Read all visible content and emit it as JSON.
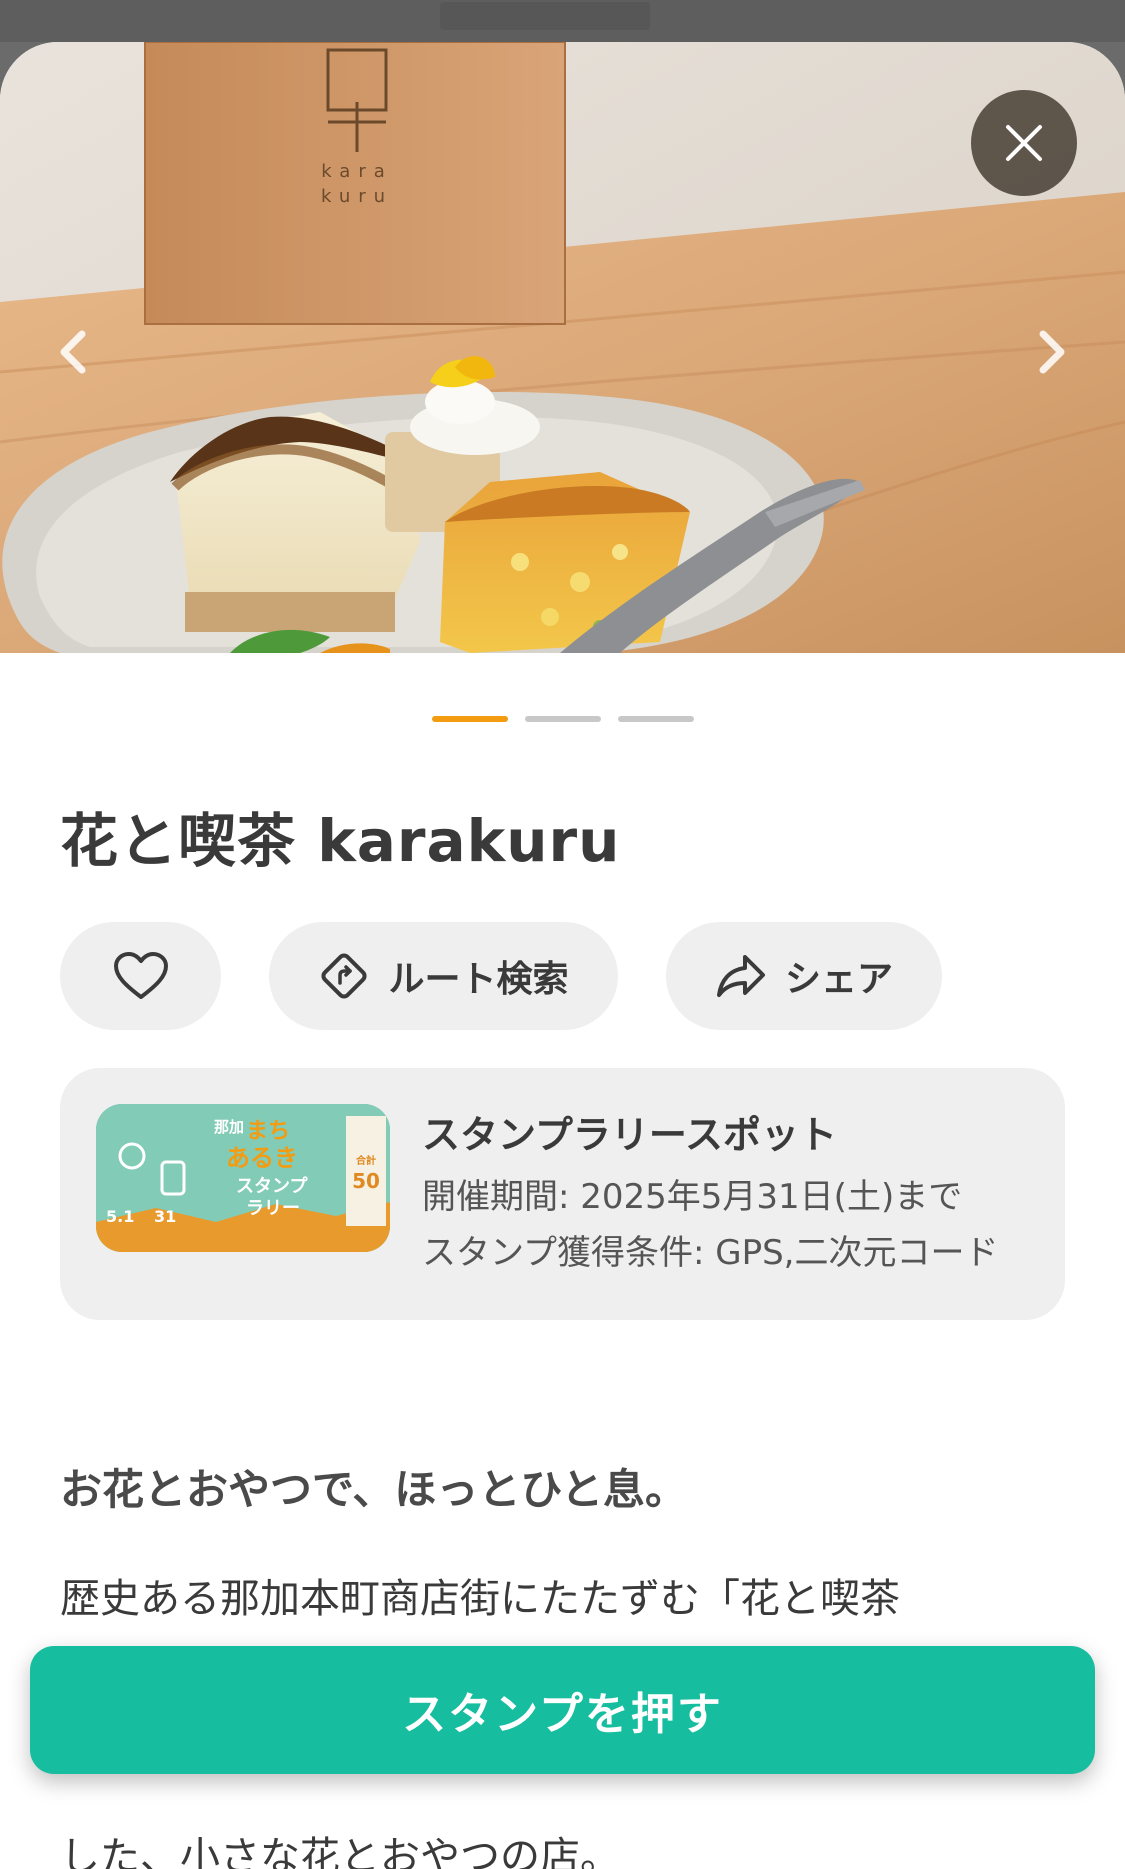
{
  "hero": {
    "close_icon": "close-icon",
    "prev_icon": "chevron-left-icon",
    "next_icon": "chevron-right-icon",
    "sign_text_line1": "kara",
    "sign_text_line2": "kuru",
    "carousel_count": 3,
    "carousel_active": 0
  },
  "shop": {
    "title": "花と喫茶 karakuru"
  },
  "actions": {
    "favorite_icon": "heart-icon",
    "route_label": "ルート検索",
    "route_icon": "route-sign-icon",
    "share_label": "シェア",
    "share_icon": "share-icon"
  },
  "stamp_rally": {
    "title": "スタンプラリースポット",
    "period": "開催期間: 2025年5月31日(土)まで",
    "conditions": "スタンプ獲得条件: GPS,二次元コード",
    "thumb": {
      "line1": "那加",
      "line2": "まち",
      "line3": "あるき",
      "line4": "スタンプ",
      "line5": "ラリー",
      "dates": "5.1",
      "dates2": "31",
      "count_label": "合計",
      "count": "50"
    }
  },
  "description": {
    "lead": "お花とおやつで、ほっとひと息。",
    "paragraph": "歴史ある那加本町商店街にたたずむ「花と喫茶",
    "tail": "した、小さな花とおやつの店。"
  },
  "cta": {
    "label": "スタンプを押す"
  },
  "colors": {
    "accent": "#16bd9f",
    "indicator_active": "#f39c12",
    "indicator_inactive": "#c8c8c8",
    "pill_bg": "#efefef"
  }
}
